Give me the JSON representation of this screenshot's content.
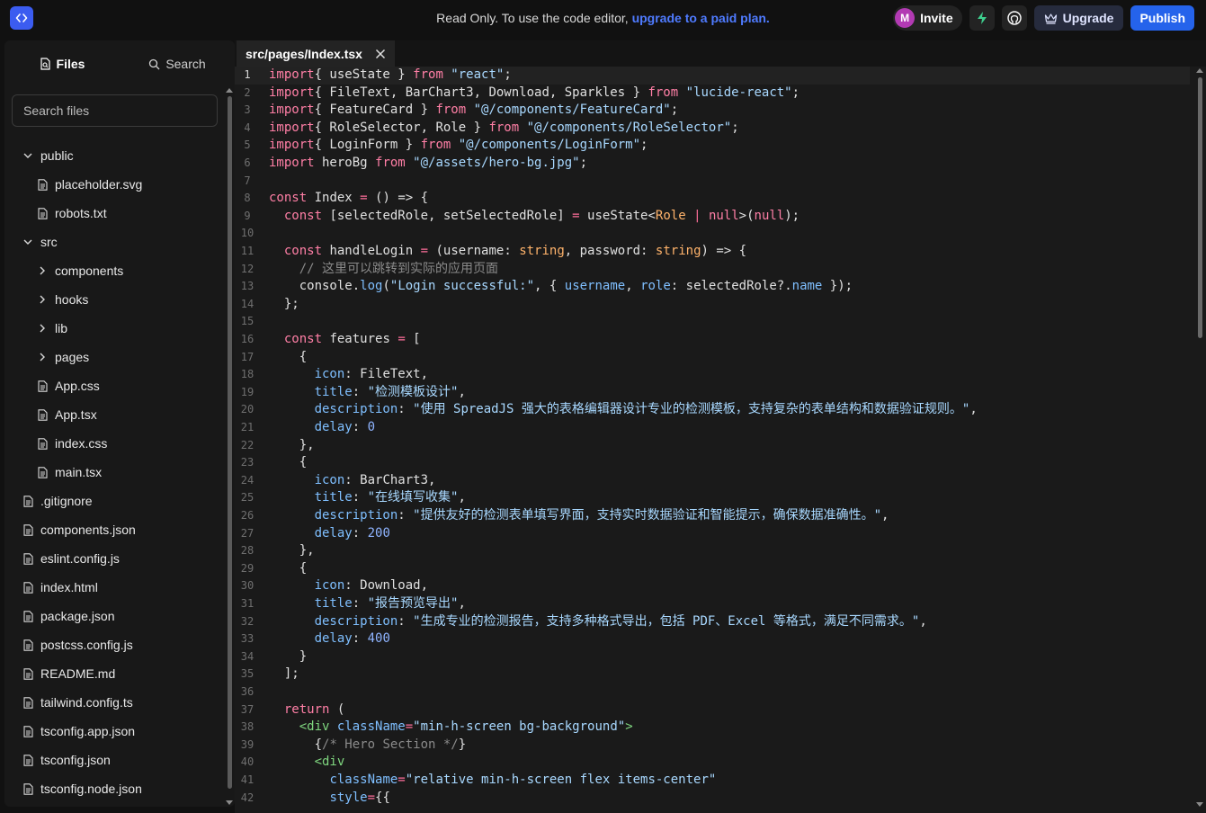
{
  "topbar": {
    "notice_text": "Read Only. To use the code editor, ",
    "notice_link": "upgrade to a paid plan.",
    "avatar_initial": "M",
    "invite_label": "Invite",
    "upgrade_label": "Upgrade",
    "publish_label": "Publish"
  },
  "sidebar": {
    "tabs": [
      {
        "label": "Files",
        "icon": "file-search-icon",
        "active": true
      },
      {
        "label": "Search",
        "icon": "search-icon",
        "active": false
      }
    ],
    "search_placeholder": "Search files",
    "tree": [
      {
        "label": "public",
        "kind": "folder-open",
        "depth": 0
      },
      {
        "label": "placeholder.svg",
        "kind": "file",
        "depth": 1
      },
      {
        "label": "robots.txt",
        "kind": "file",
        "depth": 1
      },
      {
        "label": "src",
        "kind": "folder-open",
        "depth": 0
      },
      {
        "label": "components",
        "kind": "folder",
        "depth": 1
      },
      {
        "label": "hooks",
        "kind": "folder",
        "depth": 1
      },
      {
        "label": "lib",
        "kind": "folder",
        "depth": 1
      },
      {
        "label": "pages",
        "kind": "folder",
        "depth": 1
      },
      {
        "label": "App.css",
        "kind": "file",
        "depth": 1
      },
      {
        "label": "App.tsx",
        "kind": "file",
        "depth": 1
      },
      {
        "label": "index.css",
        "kind": "file",
        "depth": 1
      },
      {
        "label": "main.tsx",
        "kind": "file",
        "depth": 1
      },
      {
        "label": ".gitignore",
        "kind": "file",
        "depth": 0
      },
      {
        "label": "components.json",
        "kind": "file",
        "depth": 0
      },
      {
        "label": "eslint.config.js",
        "kind": "file",
        "depth": 0
      },
      {
        "label": "index.html",
        "kind": "file",
        "depth": 0
      },
      {
        "label": "package.json",
        "kind": "file",
        "depth": 0
      },
      {
        "label": "postcss.config.js",
        "kind": "file",
        "depth": 0
      },
      {
        "label": "README.md",
        "kind": "file",
        "depth": 0
      },
      {
        "label": "tailwind.config.ts",
        "kind": "file",
        "depth": 0
      },
      {
        "label": "tsconfig.app.json",
        "kind": "file",
        "depth": 0
      },
      {
        "label": "tsconfig.json",
        "kind": "file",
        "depth": 0
      },
      {
        "label": "tsconfig.node.json",
        "kind": "file",
        "depth": 0
      }
    ]
  },
  "editor": {
    "tab_label": "src/pages/Index.tsx",
    "current_line": 1,
    "lines": [
      [
        [
          "kw",
          "import"
        ],
        [
          "",
          "{ useState } "
        ],
        [
          "kw",
          "from"
        ],
        [
          "str",
          " \"react\""
        ],
        [
          "",
          ";"
        ]
      ],
      [
        [
          "kw",
          "import"
        ],
        [
          "",
          "{ FileText, BarChart3, Download, Sparkles } "
        ],
        [
          "kw",
          "from"
        ],
        [
          "str",
          " \"lucide-react\""
        ],
        [
          "",
          ";"
        ]
      ],
      [
        [
          "kw",
          "import"
        ],
        [
          "",
          "{ FeatureCard } "
        ],
        [
          "kw",
          "from"
        ],
        [
          "str",
          " \"@/components/FeatureCard\""
        ],
        [
          "",
          ";"
        ]
      ],
      [
        [
          "kw",
          "import"
        ],
        [
          "",
          "{ RoleSelector, Role } "
        ],
        [
          "kw",
          "from"
        ],
        [
          "str",
          " \"@/components/RoleSelector\""
        ],
        [
          "",
          ";"
        ]
      ],
      [
        [
          "kw",
          "import"
        ],
        [
          "",
          "{ LoginForm } "
        ],
        [
          "kw",
          "from"
        ],
        [
          "str",
          " \"@/components/LoginForm\""
        ],
        [
          "",
          ";"
        ]
      ],
      [
        [
          "kw",
          "import"
        ],
        [
          "",
          " heroBg "
        ],
        [
          "kw",
          "from"
        ],
        [
          "str",
          " \"@/assets/hero-bg.jpg\""
        ],
        [
          "",
          ";"
        ]
      ],
      [],
      [
        [
          "kw",
          "const"
        ],
        [
          "",
          " Index "
        ],
        [
          "kw2",
          "="
        ],
        [
          "",
          " () => {"
        ]
      ],
      [
        [
          "",
          "  "
        ],
        [
          "kw",
          "const"
        ],
        [
          "",
          " [selectedRole, setSelectedRole] "
        ],
        [
          "kw2",
          "="
        ],
        [
          "",
          " useState<"
        ],
        [
          "type",
          "Role"
        ],
        [
          "",
          " "
        ],
        [
          "kw2",
          "|"
        ],
        [
          "",
          " "
        ],
        [
          "kw",
          "null"
        ],
        [
          "",
          ">("
        ],
        [
          "kw",
          "null"
        ],
        [
          "",
          ");"
        ]
      ],
      [],
      [
        [
          "",
          "  "
        ],
        [
          "kw",
          "const"
        ],
        [
          "",
          " handleLogin "
        ],
        [
          "kw2",
          "="
        ],
        [
          "",
          " (username: "
        ],
        [
          "type",
          "string"
        ],
        [
          "",
          ", password: "
        ],
        [
          "type",
          "string"
        ],
        [
          "",
          ") => {"
        ]
      ],
      [
        [
          "cm",
          "    // 这里可以跳转到实际的应用页面"
        ]
      ],
      [
        [
          "",
          "    console."
        ],
        [
          "prop",
          "log"
        ],
        [
          "",
          "("
        ],
        [
          "str",
          "\"Login successful:\""
        ],
        [
          "",
          ", { "
        ],
        [
          "prop",
          "username"
        ],
        [
          "",
          ", "
        ],
        [
          "prop",
          "role"
        ],
        [
          "",
          ": selectedRole?."
        ],
        [
          "prop",
          "name"
        ],
        [
          "",
          " });"
        ]
      ],
      [
        [
          "",
          "  };"
        ]
      ],
      [],
      [
        [
          "",
          "  "
        ],
        [
          "kw",
          "const"
        ],
        [
          "",
          " features "
        ],
        [
          "kw2",
          "="
        ],
        [
          "",
          " ["
        ]
      ],
      [
        [
          "",
          "    {"
        ]
      ],
      [
        [
          "",
          "      "
        ],
        [
          "prop",
          "icon"
        ],
        [
          "",
          ": FileText,"
        ]
      ],
      [
        [
          "",
          "      "
        ],
        [
          "prop",
          "title"
        ],
        [
          "",
          ": "
        ],
        [
          "str",
          "\"检测模板设计\""
        ],
        [
          "",
          ","
        ]
      ],
      [
        [
          "",
          "      "
        ],
        [
          "prop",
          "description"
        ],
        [
          "",
          ": "
        ],
        [
          "str",
          "\"使用 SpreadJS 强大的表格编辑器设计专业的检测模板，支持复杂的表单结构和数据验证规则。\""
        ],
        [
          "",
          ","
        ]
      ],
      [
        [
          "",
          "      "
        ],
        [
          "prop",
          "delay"
        ],
        [
          "",
          ": "
        ],
        [
          "num",
          "0"
        ]
      ],
      [
        [
          "",
          "    },"
        ]
      ],
      [
        [
          "",
          "    {"
        ]
      ],
      [
        [
          "",
          "      "
        ],
        [
          "prop",
          "icon"
        ],
        [
          "",
          ": BarChart3,"
        ]
      ],
      [
        [
          "",
          "      "
        ],
        [
          "prop",
          "title"
        ],
        [
          "",
          ": "
        ],
        [
          "str",
          "\"在线填写收集\""
        ],
        [
          "",
          ","
        ]
      ],
      [
        [
          "",
          "      "
        ],
        [
          "prop",
          "description"
        ],
        [
          "",
          ": "
        ],
        [
          "str",
          "\"提供友好的检测表单填写界面，支持实时数据验证和智能提示，确保数据准确性。\""
        ],
        [
          "",
          ","
        ]
      ],
      [
        [
          "",
          "      "
        ],
        [
          "prop",
          "delay"
        ],
        [
          "",
          ": "
        ],
        [
          "num",
          "200"
        ]
      ],
      [
        [
          "",
          "    },"
        ]
      ],
      [
        [
          "",
          "    {"
        ]
      ],
      [
        [
          "",
          "      "
        ],
        [
          "prop",
          "icon"
        ],
        [
          "",
          ": Download,"
        ]
      ],
      [
        [
          "",
          "      "
        ],
        [
          "prop",
          "title"
        ],
        [
          "",
          ": "
        ],
        [
          "str",
          "\"报告预览导出\""
        ],
        [
          "",
          ","
        ]
      ],
      [
        [
          "",
          "      "
        ],
        [
          "prop",
          "description"
        ],
        [
          "",
          ": "
        ],
        [
          "str",
          "\"生成专业的检测报告，支持多种格式导出，包括 PDF、Excel 等格式，满足不同需求。\""
        ],
        [
          "",
          ","
        ]
      ],
      [
        [
          "",
          "      "
        ],
        [
          "prop",
          "delay"
        ],
        [
          "",
          ": "
        ],
        [
          "num",
          "400"
        ]
      ],
      [
        [
          "",
          "    }"
        ]
      ],
      [
        [
          "",
          "  ];"
        ]
      ],
      [],
      [
        [
          "",
          "  "
        ],
        [
          "kw",
          "return"
        ],
        [
          "",
          " ("
        ]
      ],
      [
        [
          "",
          "    "
        ],
        [
          "tag",
          "<div"
        ],
        [
          "",
          " "
        ],
        [
          "prop",
          "className"
        ],
        [
          "kw2",
          "="
        ],
        [
          "str",
          "\"min-h-screen bg-background\""
        ],
        [
          "tag",
          ">"
        ]
      ],
      [
        [
          "",
          "      {"
        ],
        [
          "cm",
          "/* Hero Section */"
        ],
        [
          "",
          "}"
        ]
      ],
      [
        [
          "",
          "      "
        ],
        [
          "tag",
          "<div"
        ]
      ],
      [
        [
          "",
          "        "
        ],
        [
          "prop",
          "className"
        ],
        [
          "kw2",
          "="
        ],
        [
          "str",
          "\"relative min-h-screen flex items-center\""
        ]
      ],
      [
        [
          "",
          "        "
        ],
        [
          "prop",
          "style"
        ],
        [
          "kw2",
          "="
        ],
        [
          "",
          "{{"
        ]
      ]
    ]
  }
}
